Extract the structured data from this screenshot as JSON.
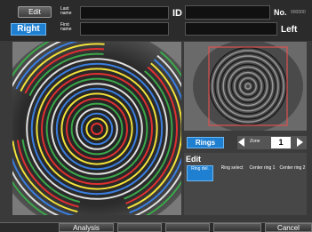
{
  "header": {
    "edit_label": "Edit",
    "last_label": "Last name",
    "first_label": "First name",
    "eye_right": "Right",
    "id_label": "ID",
    "no_label": "No.",
    "no_value": "000000",
    "eye_left": "Left"
  },
  "controls": {
    "rings_label": "Rings",
    "zone_label": "Zone",
    "zone_value": "1",
    "edit_title": "Edit",
    "options": [
      {
        "label": "Ring del."
      },
      {
        "label": "Ring select"
      },
      {
        "label": "Center ring 1"
      },
      {
        "label": "Center ring 2"
      }
    ]
  },
  "footer": {
    "analysis_label": "Analysis",
    "cancel_label": "Cancel"
  },
  "colors": {
    "accent": "#1f7fd0",
    "ring_colors": [
      "#e03030",
      "#f2e23a",
      "#3a7fe0",
      "#e0e0e0",
      "#3aa84a",
      "#e03030",
      "#f2e23a",
      "#3a7fe0",
      "#e0e0e0",
      "#3aa84a",
      "#e03030",
      "#f2e23a",
      "#3a7fe0",
      "#e0e0e0",
      "#3aa84a",
      "#e03030",
      "#f2e23a",
      "#3a7fe0",
      "#e0e0e0",
      "#3aa84a"
    ]
  }
}
